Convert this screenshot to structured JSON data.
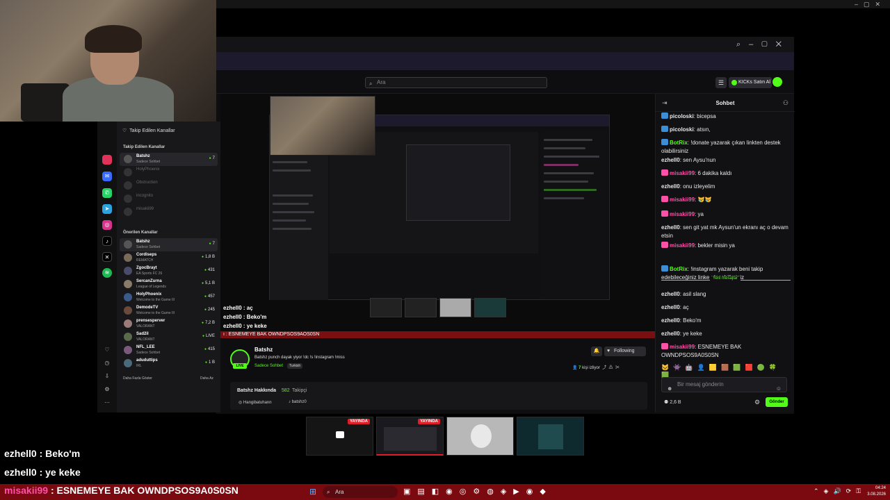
{
  "browser": {
    "url_fragment": "tshz",
    "search_placeholder": "Ara",
    "kicks_label": "KICKs Satın Al"
  },
  "sidebar": {
    "header": "Takip Edilen Kanallar",
    "followed_section": "Takip Edilen Kanallar",
    "followed": [
      {
        "name": "Batshz",
        "sub": "Sadece Sohbet",
        "count": "7"
      },
      {
        "name": "HolyPhoenix",
        "sub": "",
        "count": ""
      },
      {
        "name": "Obstruction",
        "sub": "",
        "count": ""
      },
      {
        "name": "incognito",
        "sub": "",
        "count": ""
      },
      {
        "name": "misakii99",
        "sub": "",
        "count": ""
      }
    ],
    "recommended_section": "Önerilen Kanallar",
    "recommended": [
      {
        "name": "Batshz",
        "sub": "Sadece Sohbet",
        "count": "7"
      },
      {
        "name": "Cordiseps",
        "sub": "REMATCH",
        "count": "1,8 B"
      },
      {
        "name": "ZgocBrayt",
        "sub": "EA Sports FC 26",
        "count": "431"
      },
      {
        "name": "SercanZurna",
        "sub": "League of Legends",
        "count": "5,1 B"
      },
      {
        "name": "HolyPhoenix",
        "sub": "Welcome to the Game III",
        "count": "457"
      },
      {
        "name": "DemodeTV",
        "sub": "Welcome to the Game III",
        "count": "245"
      },
      {
        "name": "prensesperver",
        "sub": "VALORANT",
        "count": "7,2 B"
      },
      {
        "name": "Sad2il",
        "sub": "VALORANT",
        "count": "LIVE"
      },
      {
        "name": "NFL_LEE",
        "sub": "Sadece Sohbet",
        "count": "415"
      },
      {
        "name": "aduduttips",
        "sub": "IRL",
        "count": "1 B"
      }
    ],
    "show_more": "Daha Fazla Göster",
    "show_less": "Daha Az"
  },
  "video_overlay": [
    "ezhell0 : aç",
    "ezhell0 : Beko'm",
    "ezhell0 : ye keke"
  ],
  "stream_taskbar_text": "ı : ESNEMEYE BAK OWNDPSOS9AOS0SN",
  "stream": {
    "streamer": "Batshz",
    "title": "Batshz punch dayak yiyor  !dc !s !instagram !miss",
    "category": "Sadece Sohbet",
    "tag": "Turkish",
    "live": "LIVE",
    "follow_label": "Following",
    "viewers_num": "7",
    "viewers_label": "kişi izliyor",
    "about_title": "Batshz Hakkında",
    "followers": "582",
    "followers_label": "Takipçi",
    "instagram": "Hangibatuhann",
    "tiktok": "batshz0"
  },
  "chat": {
    "title": "Sohbet",
    "new_messages": "Yeni mesajlar",
    "messages": [
      {
        "user": "picoloski",
        "text": "bicepsa",
        "color": "#e8e8e8",
        "badge": "#3b8fd6"
      },
      {
        "user": "picoloski",
        "text": "atsın,",
        "color": "#e8e8e8",
        "badge": "#3b8fd6"
      },
      {
        "user": "BotRix",
        "text": "!donate yazarak çıkan linkten destek olabilirsiniz",
        "color": "#53fc18",
        "badge": "#3b8fd6"
      },
      {
        "user": "ezhell0",
        "text": "sen Aysu'nun",
        "color": "#e8e8e8",
        "badge": ""
      },
      {
        "user": "misakii99",
        "text": "6 dakika kaldı",
        "color": "#ff4fa8",
        "badge": "#ff4fa8"
      },
      {
        "user": "ezhell0",
        "text": "onu izleyelim",
        "color": "#e8e8e8",
        "badge": ""
      },
      {
        "user": "misakii99",
        "text": "😿😿",
        "color": "#ff4fa8",
        "badge": "#ff4fa8"
      },
      {
        "user": "misakii99",
        "text": "ya",
        "color": "#ff4fa8",
        "badge": "#ff4fa8"
      },
      {
        "user": "ezhell0",
        "text": "sen git yat mk Aysun'un ekranı aç o devam etsin",
        "color": "#e8e8e8",
        "badge": ""
      },
      {
        "user": "misakii99",
        "text": "bekler misin ya",
        "color": "#ff4fa8",
        "badge": "#ff4fa8"
      },
      {
        "user": "BotRix",
        "text": "!instagram yazarak beni takip edebileceğiniz linke ulaşabilirsiniz",
        "color": "#53fc18",
        "badge": "#3b8fd6"
      },
      {
        "user": "ezhell0",
        "text": "asil slang",
        "color": "#e8e8e8",
        "badge": ""
      },
      {
        "user": "ezhell0",
        "text": "aç",
        "color": "#e8e8e8",
        "badge": ""
      },
      {
        "user": "ezhell0",
        "text": "Beko'm",
        "color": "#e8e8e8",
        "badge": ""
      },
      {
        "user": "ezhell0",
        "text": "ye keke",
        "color": "#e8e8e8",
        "badge": ""
      },
      {
        "user": "misakii99",
        "text": "ESNEMEYE BAK OWNDPSOS9A0S0SN",
        "color": "#ff4fa8",
        "badge": "#ff4fa8"
      }
    ],
    "input_placeholder": "Bir mesaj gönderin",
    "kicks_count": "2,6 B",
    "send_label": "Gönder"
  },
  "thumbnails": [
    {
      "badge": "YAYINDA"
    },
    {
      "badge": "YAYINDA"
    },
    {
      "badge": ""
    },
    {
      "badge": ""
    }
  ],
  "overlay_chat": [
    "ezhell0 : Beko'm",
    "ezhell0 : ye keke"
  ],
  "overlay_last": {
    "user": "misakii99",
    "text": ": ESNEMEYE BAK OWNDPSOS9A0S0SN"
  },
  "taskbar": {
    "search": "Ara",
    "time": "04:24",
    "date": "3.08.2026"
  },
  "colors": {
    "kick_green": "#53fc18",
    "live_red": "#e01e2a",
    "taskbar_red": "#7a0a0f"
  }
}
